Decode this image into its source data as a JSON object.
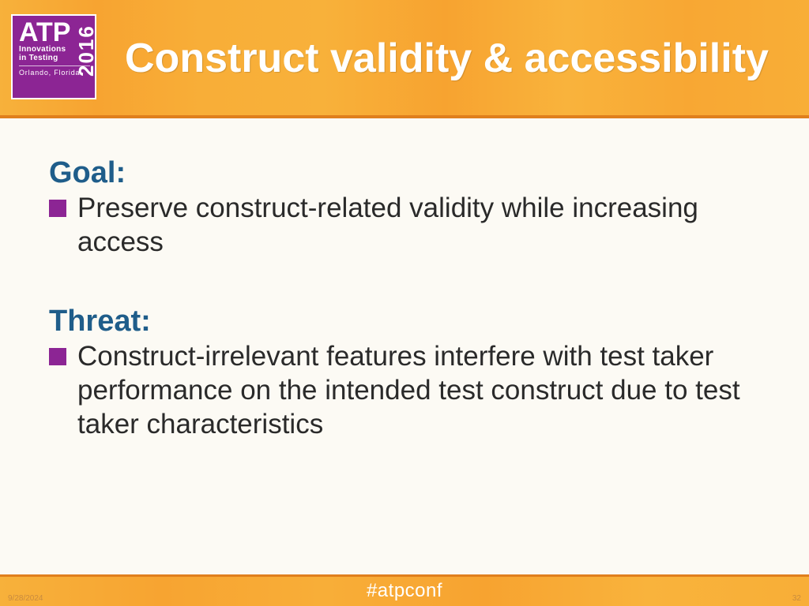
{
  "logo": {
    "brand": "ATP",
    "line1": "Innovations",
    "line2": "in Testing",
    "location": "Orlando, Florida",
    "year": "2016"
  },
  "title": "Construct validity & accessibility",
  "sections": [
    {
      "label": "Goal:",
      "bullet": "Preserve construct-related validity while increasing access"
    },
    {
      "label": "Threat:",
      "bullet": "Construct-irrelevant features interfere with test taker performance on the intended test construct due to test taker characteristics"
    }
  ],
  "footer": {
    "hashtag": "#atpconf",
    "date": "9/28/2024",
    "page": "32"
  }
}
